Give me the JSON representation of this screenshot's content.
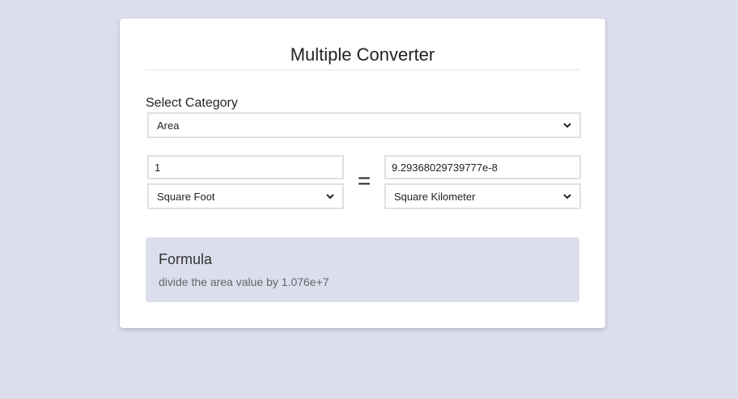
{
  "app": {
    "title": "Multiple Converter"
  },
  "category": {
    "label": "Select Category",
    "selected": "Area"
  },
  "from": {
    "value": "1",
    "unit": "Square Foot"
  },
  "equals_symbol": "=",
  "to": {
    "value": "9.29368029739777e-8",
    "unit": "Square Kilometer"
  },
  "formula": {
    "title": "Formula",
    "text": "divide the area value by 1.076e+7"
  },
  "colors": {
    "page_background": "#dcdeee",
    "card_background": "#ffffff",
    "formula_background": "#dcdeee"
  }
}
